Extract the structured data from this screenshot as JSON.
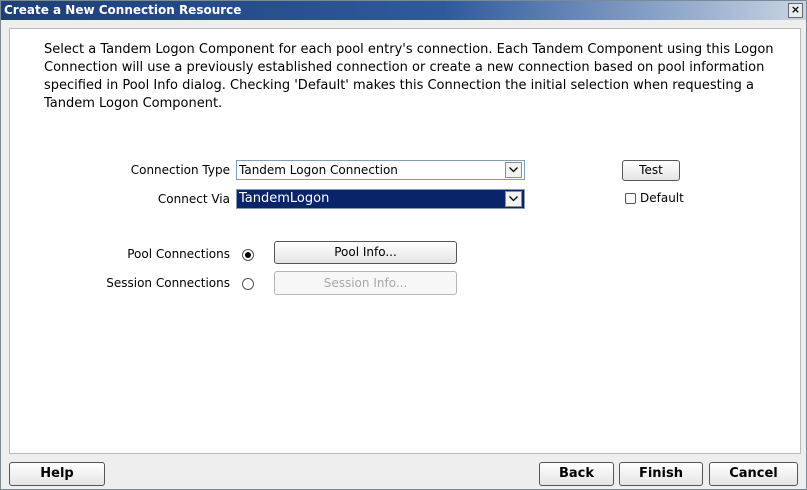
{
  "window": {
    "title": "Create a New Connection Resource",
    "close_label": "×"
  },
  "description": "Select a Tandem Logon Component for each pool entry's connection. Each Tandem Component using this Logon Connection will use a previously established connection or create a new connection based on pool information specified in Pool Info dialog. Checking 'Default' makes this Connection the initial selection when requesting a Tandem Logon Component.",
  "form": {
    "connection_type": {
      "label": "Connection Type",
      "value": "Tandem Logon Connection"
    },
    "connect_via": {
      "label": "Connect Via",
      "value": "TandemLogon"
    },
    "test_label": "Test",
    "default_label": "Default",
    "default_checked": false,
    "pool_connections": {
      "label": "Pool Connections",
      "selected": true,
      "button": "Pool Info..."
    },
    "session_connections": {
      "label": "Session Connections",
      "selected": false,
      "button": "Session Info..."
    }
  },
  "footer": {
    "help": "Help",
    "back": "Back",
    "finish": "Finish",
    "cancel": "Cancel"
  },
  "icons": {
    "close": "close-icon",
    "dropdown": "chevron-down-icon",
    "radio": "radio-dot-icon"
  },
  "colors": {
    "title_bar": "#1e3f78",
    "selection": "#0a246a"
  }
}
